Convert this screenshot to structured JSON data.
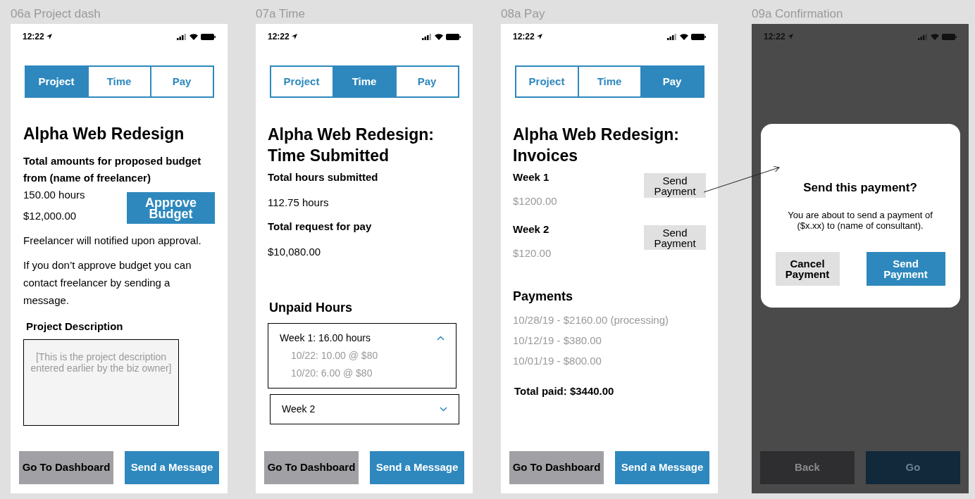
{
  "artboards": [
    {
      "label": "06a Project dash",
      "kind": "project",
      "dimmed": false,
      "time": "12:22",
      "tabs": [
        {
          "label": "Project",
          "selected": true
        },
        {
          "label": "Time",
          "selected": false
        },
        {
          "label": "Pay",
          "selected": false
        }
      ],
      "title": "Alpha Web Redesign",
      "budget_heading": "Total amounts for proposed budget from (name of freelancer)",
      "hours": "150.00 hours",
      "amount": "$12,000.00",
      "approve_button": "Approve Budget",
      "notes": [
        "Freelancer will notified upon approval.",
        "If you don’t approve budget you can contact freelancer by sending a message."
      ],
      "description_label": "Project Description",
      "description_placeholder": "[This is the project description entered earlier by the biz owner]",
      "footer_buttons": [
        {
          "label": "Go To Dashboard",
          "kind": "secondary"
        },
        {
          "label": "Send a Message",
          "kind": "primary"
        }
      ]
    },
    {
      "label": "07a Time",
      "kind": "time",
      "dimmed": false,
      "time": "12:22",
      "tabs": [
        {
          "label": "Project",
          "selected": false
        },
        {
          "label": "Time",
          "selected": true
        },
        {
          "label": "Pay",
          "selected": false
        }
      ],
      "title": "Alpha Web Redesign: Time Submitted",
      "stats": [
        {
          "label": "Total hours submitted",
          "value": "112.75 hours"
        },
        {
          "label": "Total request for pay",
          "value": "$10,080.00"
        }
      ],
      "unpaid_heading": "Unpaid Hours",
      "weeks": [
        {
          "label": "Week 1: 16.00 hours",
          "expanded": true,
          "entries": [
            "10/22: 10.00 @ $80",
            "10/20: 6.00 @ $80"
          ]
        },
        {
          "label": "Week 2",
          "expanded": false
        }
      ],
      "footer_buttons": [
        {
          "label": "Go To Dashboard",
          "kind": "secondary"
        },
        {
          "label": "Send a Message",
          "kind": "primary"
        }
      ]
    },
    {
      "label": "08a Pay",
      "kind": "pay",
      "dimmed": false,
      "time": "12:22",
      "tabs": [
        {
          "label": "Project",
          "selected": false
        },
        {
          "label": "Time",
          "selected": false
        },
        {
          "label": "Pay",
          "selected": true
        }
      ],
      "title": "Alpha Web Redesign: Invoices",
      "invoices": [
        {
          "week": "Week 1",
          "amount": "$1200.00",
          "button": "Send Payment"
        },
        {
          "week": "Week 2",
          "amount": "$120.00",
          "button": "Send Payment"
        }
      ],
      "payments_heading": "Payments",
      "payments": [
        "10/28/19 - $2160.00 (processing)",
        "10/12/19 - $380.00",
        "10/01/19 - $800.00"
      ],
      "total": "Total paid: $3440.00",
      "footer_buttons": [
        {
          "label": "Go To Dashboard",
          "kind": "secondary"
        },
        {
          "label": "Send a Message",
          "kind": "primary"
        }
      ]
    },
    {
      "label": "09a Confirmation",
      "kind": "confirmation",
      "dimmed": true,
      "time": "12:22",
      "dialog": {
        "title": "Send this payment?",
        "message": "You are about to send a payment of ($x.xx) to (name of consultant).",
        "buttons": [
          {
            "label": "Cancel Payment",
            "kind": "secondary"
          },
          {
            "label": "Send Payment",
            "kind": "primary"
          }
        ]
      },
      "footer_buttons": [
        {
          "label": "Back",
          "kind": "secondary"
        },
        {
          "label": "Go",
          "kind": "primary"
        }
      ]
    }
  ]
}
